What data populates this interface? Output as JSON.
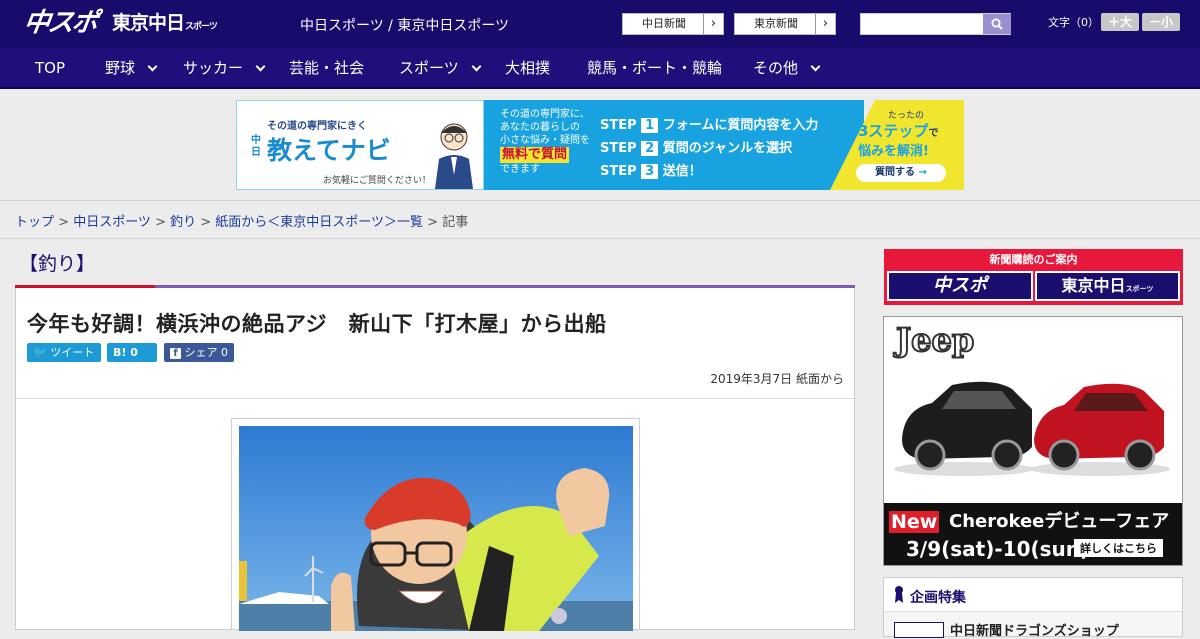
{
  "header": {
    "logo_chuspo": "中スポ",
    "logo_tokyo": "東京中日",
    "logo_tokyo_sub": "スポーツ",
    "site_links": "中日スポーツ / 東京中日スポーツ",
    "chunichi_btn": "中日新聞",
    "tokyo_btn": "東京新聞",
    "moji_label": "文字（0）",
    "size_up": "＋大",
    "size_down": "－小"
  },
  "nav": {
    "items": [
      {
        "label": "TOP"
      },
      {
        "label": "野球"
      },
      {
        "label": "サッカー"
      },
      {
        "label": "芸能・社会"
      },
      {
        "label": "スポーツ"
      },
      {
        "label": "大相撲"
      },
      {
        "label": "競馬・ボート・競輪"
      },
      {
        "label": "その他"
      }
    ]
  },
  "banner": {
    "l_top": "その道の専門家にきく",
    "l_chu": "中",
    "l_nichi": "日",
    "l_title": "教えてナビ",
    "l_bottom": "お気軽にご質問ください！",
    "m_line1": "その道の専門家に、",
    "m_line2": "あなたの暮らしの",
    "m_line3": "小さな悩み・疑問を",
    "m_free": "無料で質問",
    "m_line4": "できます",
    "step_word": "STEP",
    "step1_no": "1",
    "step1": "フォームに質問内容を入力",
    "step2_no": "2",
    "step2": "質問のジャンルを選択",
    "step3_no": "3",
    "step3": "送信！",
    "r_top": "たったの",
    "r_big": "3ステップ",
    "r_de": "で",
    "r_solve": "悩みを解消!",
    "r_btn": "質問する"
  },
  "breadcrumb": {
    "top": "トップ",
    "s1": " > ",
    "chunichi": "中日スポーツ",
    "s2": " > ",
    "tsuri": "釣り",
    "s3": " > ",
    "shimen": "紙面から＜東京中日スポーツ＞一覧",
    "s4": " > ",
    "kiji": "記事"
  },
  "article": {
    "category": "【釣り】",
    "title": "今年も好調！横浜沖の絶品アジ　新山下「打木屋」から出船",
    "tweet": "ツイート",
    "hatena": "B!",
    "hatena_count": "0",
    "share": "シェア",
    "share_count": "0",
    "date": "2019年3月7日 紙面から"
  },
  "sidebar": {
    "sub_title": "新聞購読のご案内",
    "sub_chuspo": "中スポ",
    "sub_tokyo": "東京中日",
    "sub_tokyo_small": "スポーツ",
    "ad_brand": "Jeep",
    "ad_new": "New",
    "ad_title": "Cherokeeデビューフェア",
    "ad_date": "3/9(sat)-10(sun)",
    "ad_detail": "詳しくはこちら",
    "kikaku_title": "企画特集",
    "kikaku_item": "中日新聞ドラゴンズショップ"
  },
  "colors": {
    "header_bg": "#170b6b",
    "nav_bg": "#1f0f7a",
    "accent_red": "#c8102e",
    "accent_purple": "#7a5fb0",
    "link": "#1a3a9c"
  }
}
